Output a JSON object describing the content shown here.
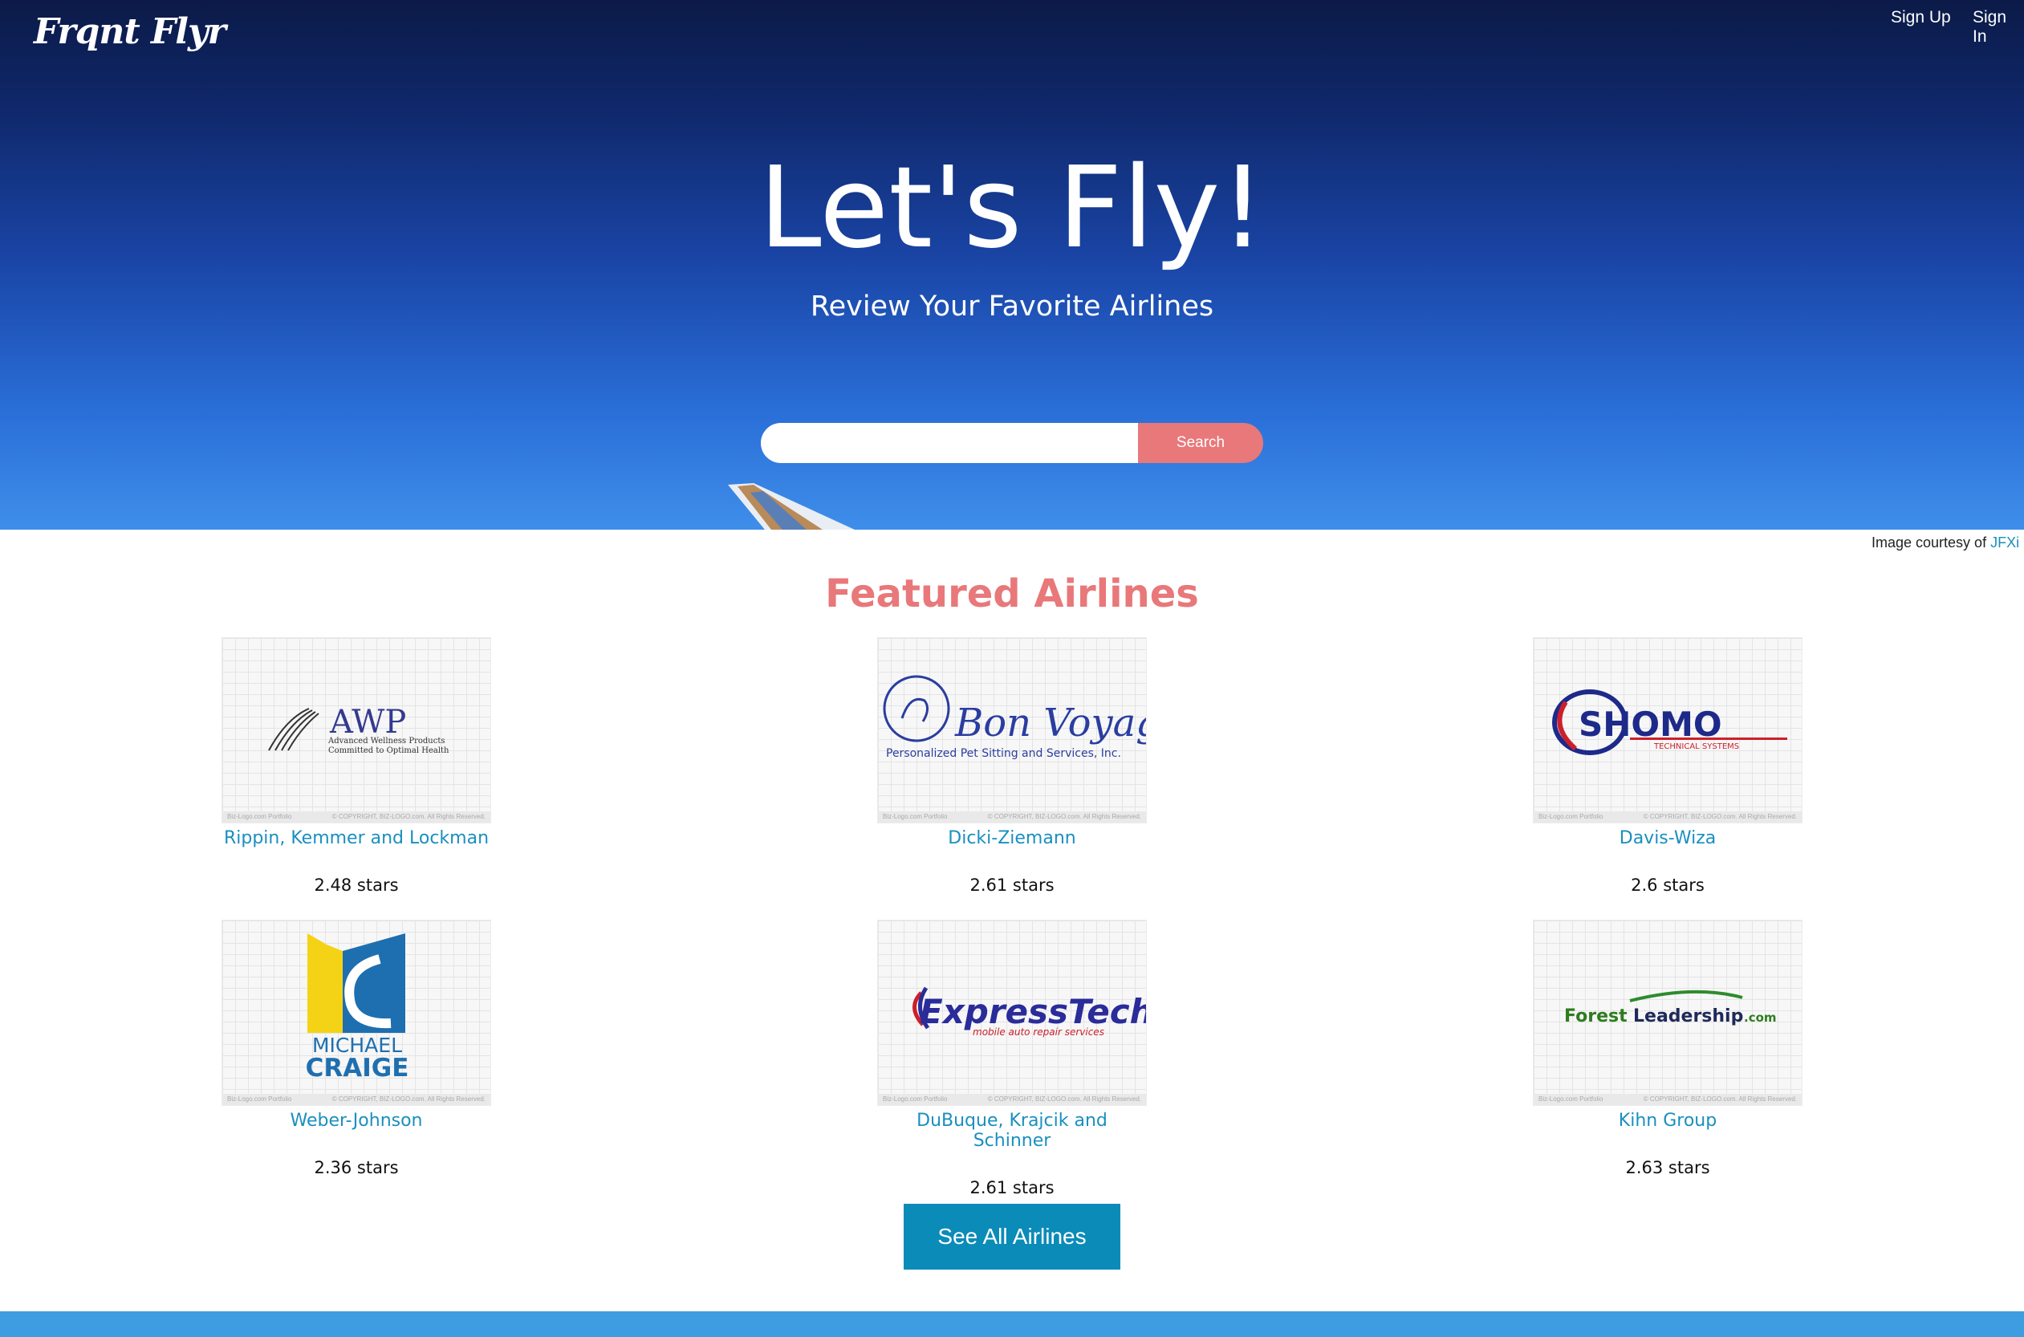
{
  "header": {
    "logo": "Frqnt Flyr",
    "nav": {
      "sign_up": "Sign Up",
      "sign_in": "Sign In"
    }
  },
  "hero": {
    "title": "Let's Fly!",
    "subtitle": "Review Your Favorite Airlines",
    "search": {
      "placeholder": "",
      "value": "",
      "button_label": "Search"
    },
    "credit": {
      "text": "Image courtesy of",
      "link": "JFXi"
    }
  },
  "featured": {
    "title": "Featured Airlines",
    "airlines": [
      {
        "name": "Rippin, Kemmer and Lockman",
        "rating": "2.48 stars",
        "logo": "awp-logo",
        "logo_text": "AWP",
        "logo_tagline": "Advanced Wellness Products",
        "logo_tagline2": "Committed to Optimal Health"
      },
      {
        "name": "Dicki-Ziemann",
        "rating": "2.61 stars",
        "logo": "bon-voyage-logo",
        "logo_text": "Bon Voyage",
        "logo_tagline": "Personalized Pet Sitting and Services, Inc."
      },
      {
        "name": "Davis-Wiza",
        "rating": "2.6 stars",
        "logo": "shomo-logo",
        "logo_text": "SHOMO",
        "logo_tagline": "TECHNICAL SYSTEMS"
      },
      {
        "name": "Weber-Johnson",
        "rating": "2.36 stars",
        "logo": "michael-craige-logo",
        "logo_text": "MICHAEL",
        "logo_tagline": "CRAIGE"
      },
      {
        "name": "DuBuque, Krajcik and Schinner",
        "rating": "2.61 stars",
        "logo": "expresstech-logo",
        "logo_text": "ExpressTech",
        "logo_tagline": "mobile auto repair services"
      },
      {
        "name": "Kihn Group",
        "rating": "2.63 stars",
        "logo": "forestleadership-logo",
        "logo_text": "Forest",
        "logo_text2": "Leadership",
        "logo_suffix": ".com"
      }
    ],
    "logo_footer_left": "Biz-Logo.com Portfolio",
    "logo_footer_right": "© COPYRIGHT, BIZ-LOGO.com. All Rights Reserved.",
    "see_all_label": "See All Airlines"
  },
  "colors": {
    "accent": "#e8787a",
    "link": "#1a8fbf",
    "button": "#0b8bb8",
    "footer": "#3d9de0"
  }
}
